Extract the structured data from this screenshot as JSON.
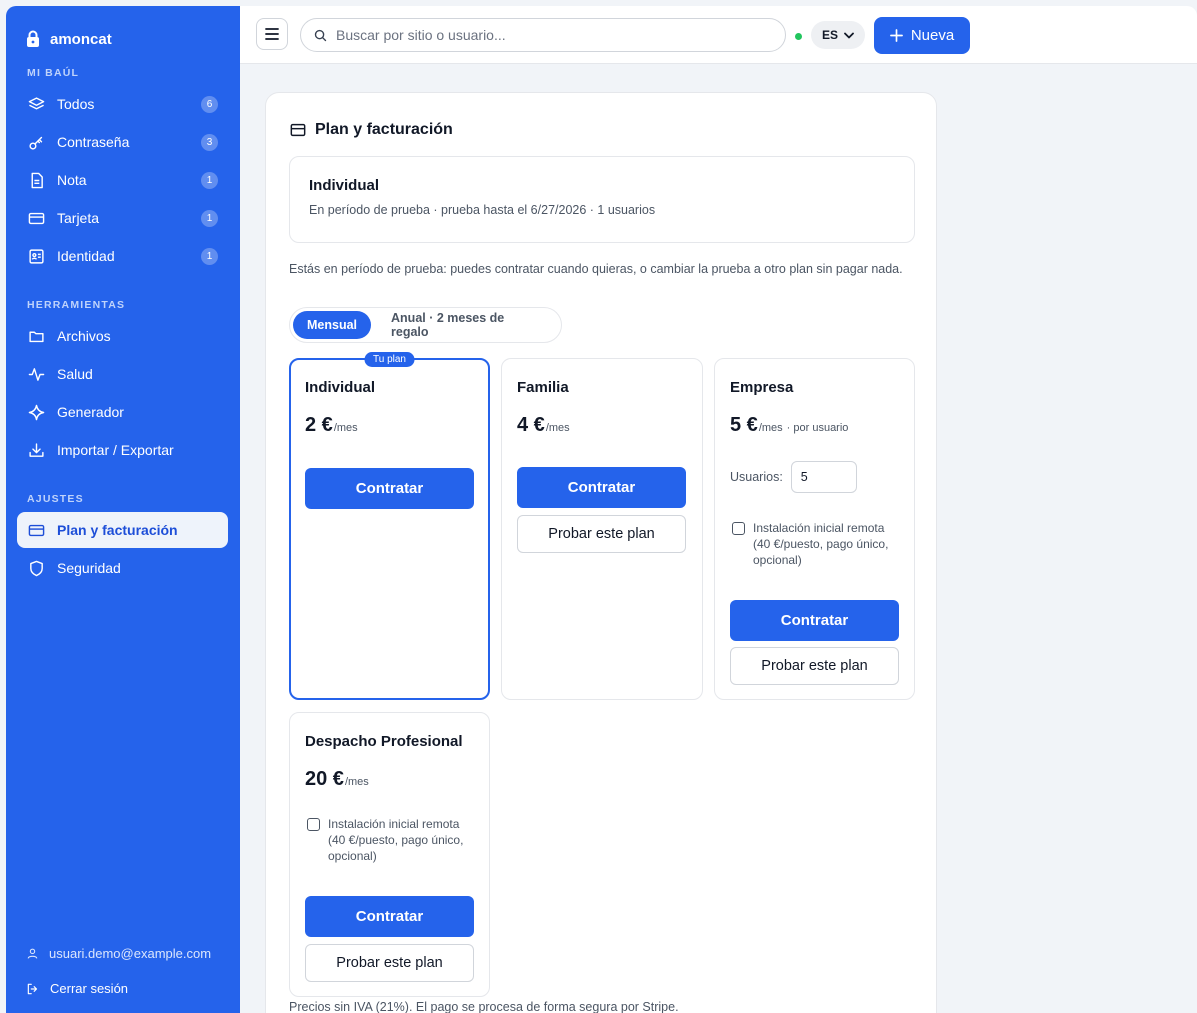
{
  "app": {
    "name": "amoncat"
  },
  "sidebar": {
    "sections": [
      {
        "label": "MI BAÚL"
      },
      {
        "label": "HERRAMIENTAS"
      },
      {
        "label": "AJUSTES"
      }
    ],
    "vault_items": [
      {
        "label": "Todos",
        "count": "6",
        "icon": "layers-icon"
      },
      {
        "label": "Contraseña",
        "count": "3",
        "icon": "key-icon"
      },
      {
        "label": "Nota",
        "count": "1",
        "icon": "note-icon"
      },
      {
        "label": "Tarjeta",
        "count": "1",
        "icon": "card-icon"
      },
      {
        "label": "Identidad",
        "count": "1",
        "icon": "id-card-icon"
      }
    ],
    "tool_items": [
      {
        "label": "Archivos",
        "icon": "folder-icon"
      },
      {
        "label": "Salud",
        "icon": "pulse-icon"
      },
      {
        "label": "Generador",
        "icon": "sparkle-icon"
      },
      {
        "label": "Importar / Exportar",
        "icon": "download-icon"
      }
    ],
    "settings_items": [
      {
        "label": "Plan y facturación",
        "icon": "card-icon",
        "active": true
      },
      {
        "label": "Seguridad",
        "icon": "shield-icon"
      }
    ],
    "user_email": "usuari.demo@example.com",
    "logout_label": "Cerrar sesión"
  },
  "topbar": {
    "search_placeholder": "Buscar por sitio o usuario...",
    "language": "ES",
    "new_label": "Nueva"
  },
  "billing": {
    "title": "Plan y facturación",
    "current_plan": {
      "name": "Individual",
      "detail": "En período de prueba · prueba hasta el 6/27/2026 · 1 usuarios"
    },
    "trial_note": "Estás en período de prueba: puedes contratar cuando quieras, o cambiar la prueba a otro plan sin pagar nada.",
    "billing_toggle": {
      "monthly": "Mensual",
      "annual": "Anual · 2 meses de regalo",
      "selected": "monthly"
    },
    "current_badge": "Tu plan",
    "plans": [
      {
        "name": "Individual",
        "price": "2 €",
        "per": "/mes",
        "extra": "",
        "contract_label": "Contratar",
        "is_current": true
      },
      {
        "name": "Familia",
        "price": "4 €",
        "per": "/mes",
        "extra": "",
        "contract_label": "Contratar",
        "try_label": "Probar este plan"
      },
      {
        "name": "Empresa",
        "price": "5 €",
        "per": "/mes",
        "extra": "· por usuario",
        "users_label": "Usuarios:",
        "users_value": "5",
        "install_label": "Instalación inicial remota (40 €/puesto, pago único, opcional)",
        "contract_label": "Contratar",
        "try_label": "Probar este plan"
      },
      {
        "name": "Despacho Profesional",
        "price": "20 €",
        "per": "/mes",
        "extra": "",
        "install_label": "Instalación inicial remota (40 €/puesto, pago único, opcional)",
        "contract_label": "Contratar",
        "try_label": "Probar este plan"
      }
    ],
    "footer_note": "Precios sin IVA (21%). El pago se procesa de forma segura por Stripe."
  },
  "colors": {
    "primary": "#2563eb",
    "status_online": "#22c55e",
    "active_item_bg": "#eef3fb"
  }
}
